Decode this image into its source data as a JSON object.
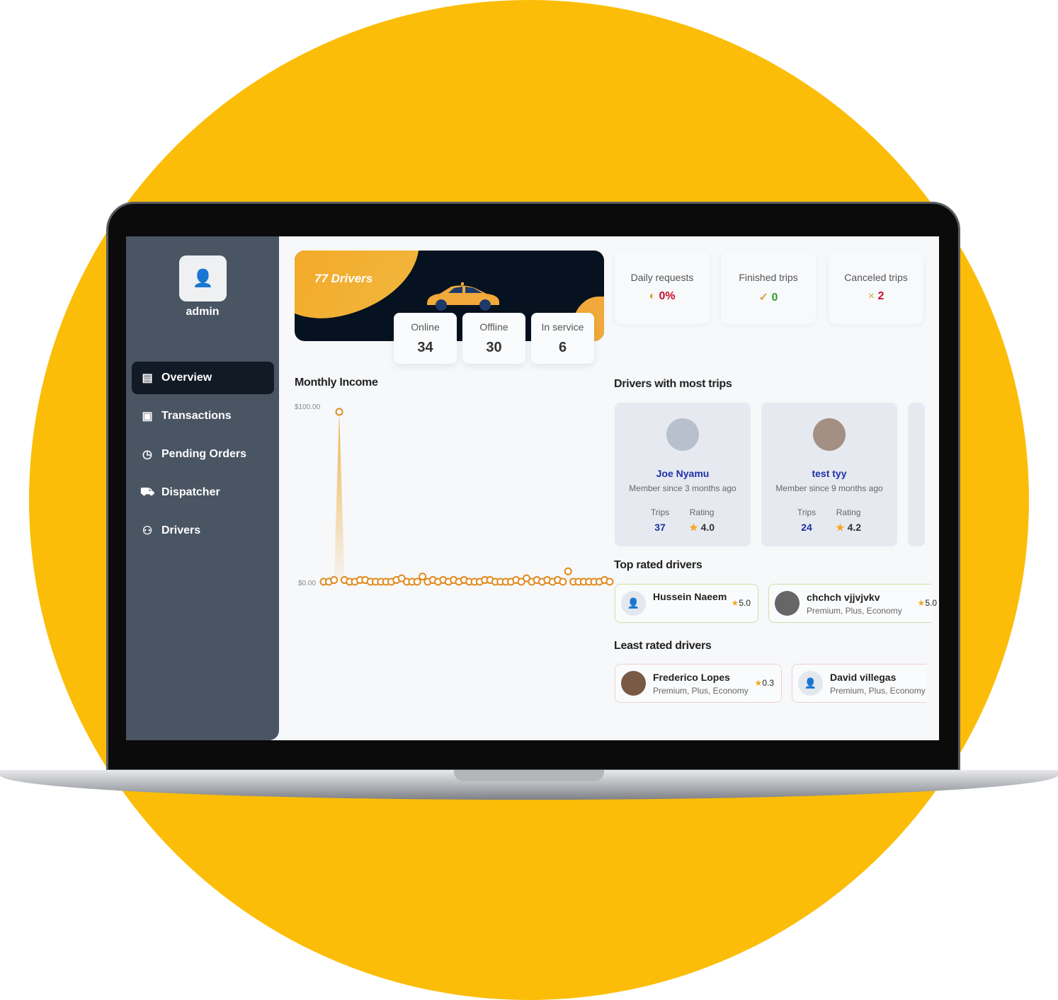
{
  "sidebar": {
    "user": "admin",
    "items": [
      {
        "label": "Overview",
        "icon": "bar-chart-icon",
        "active": true
      },
      {
        "label": "Transactions",
        "icon": "wallet-icon"
      },
      {
        "label": "Pending Orders",
        "icon": "clock-icon"
      },
      {
        "label": "Dispatcher",
        "icon": "car-icon"
      },
      {
        "label": "Drivers",
        "icon": "users-icon"
      }
    ]
  },
  "hero": {
    "title": "77 Drivers",
    "stats": [
      {
        "label": "Online",
        "value": "34"
      },
      {
        "label": "Offline",
        "value": "30"
      },
      {
        "label": "In service",
        "value": "6"
      }
    ]
  },
  "cards": [
    {
      "label": "Daily requests",
      "value": "0%",
      "icon": "speedometer-icon",
      "color": "#c8102e"
    },
    {
      "label": "Finished trips",
      "value": "0",
      "icon": "shield-check-icon",
      "color": "#2e9e2e"
    },
    {
      "label": "Canceled trips",
      "value": "2",
      "icon": "x-icon",
      "color": "#c8102e"
    }
  ],
  "income": {
    "title": "Monthly Income"
  },
  "chart_data": {
    "type": "line",
    "title": "Monthly Income",
    "yticks": [
      "$100.00",
      "$0.00"
    ],
    "ylim": [
      0,
      100
    ],
    "values": [
      0,
      0,
      1,
      98,
      1,
      0,
      0,
      1,
      1,
      0,
      0,
      0,
      0,
      0,
      1,
      2,
      0,
      0,
      0,
      3,
      0,
      1,
      0,
      1,
      0,
      1,
      0,
      1,
      0,
      0,
      0,
      1,
      1,
      0,
      0,
      0,
      0,
      1,
      0,
      2,
      0,
      1,
      0,
      1,
      0,
      1,
      0,
      6,
      0,
      0,
      0,
      0,
      0,
      0,
      1,
      0
    ],
    "color": "#e08a1e"
  },
  "most_trips": {
    "title": "Drivers with most trips",
    "trips_label": "Trips",
    "rating_label": "Rating",
    "drivers": [
      {
        "name": "Joe Nyamu",
        "since": "Member since 3 months ago",
        "trips": "37",
        "rating": "4.0"
      },
      {
        "name": "test tyy",
        "since": "Member since 9 months ago",
        "trips": "24",
        "rating": "4.2"
      }
    ]
  },
  "top_rated": {
    "title": "Top rated drivers",
    "drivers": [
      {
        "name": "Hussein Naeem",
        "classes": "",
        "rating": "5.0"
      },
      {
        "name": "chchch vjjvjvkv",
        "classes": "Premium, Plus, Economy",
        "rating": "5.0"
      }
    ]
  },
  "least_rated": {
    "title": "Least rated drivers",
    "drivers": [
      {
        "name": "Frederico Lopes",
        "classes": "Premium, Plus, Economy",
        "rating": "0.3"
      },
      {
        "name": "David villegas",
        "classes": "Premium, Plus, Economy",
        "rating": ""
      }
    ]
  }
}
